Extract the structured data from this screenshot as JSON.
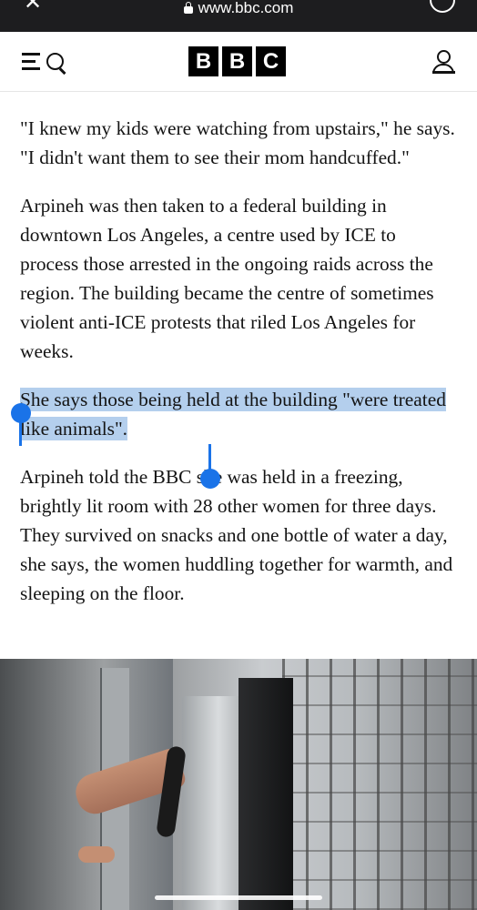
{
  "browser": {
    "url": "www.bbc.com"
  },
  "header": {
    "logo_letters": [
      "B",
      "B",
      "C"
    ]
  },
  "article": {
    "paragraphs": [
      "\"I knew my kids were watching from upstairs,\" he says. \"I didn't want them to see their mom handcuffed.\"",
      "Arpineh was then taken to a federal building in downtown Los Angeles, a centre used by ICE to process those arrested in the ongoing raids across the region. The building became the centre of sometimes violent anti-ICE protests that riled Los Angeles for weeks.",
      "She says those being held at the building \"were treated like animals\".",
      "Arpineh told the BBC she was held in a freezing, brightly lit room with 28 other women for three days. They survived on snacks and one bottle of water a day, she says, the women huddling together for warmth, and sleeping on the floor."
    ],
    "selected_paragraph_index": 2
  },
  "colors": {
    "selection_highlight": "#b4cfed",
    "selection_handle": "#1a73e8",
    "browser_bar": "#1d1d1f",
    "text": "#141414"
  },
  "icons": {
    "close": "close-icon",
    "lock": "lock-icon",
    "reload": "reload-icon",
    "menu": "menu-icon",
    "search": "search-icon",
    "account": "account-icon"
  }
}
